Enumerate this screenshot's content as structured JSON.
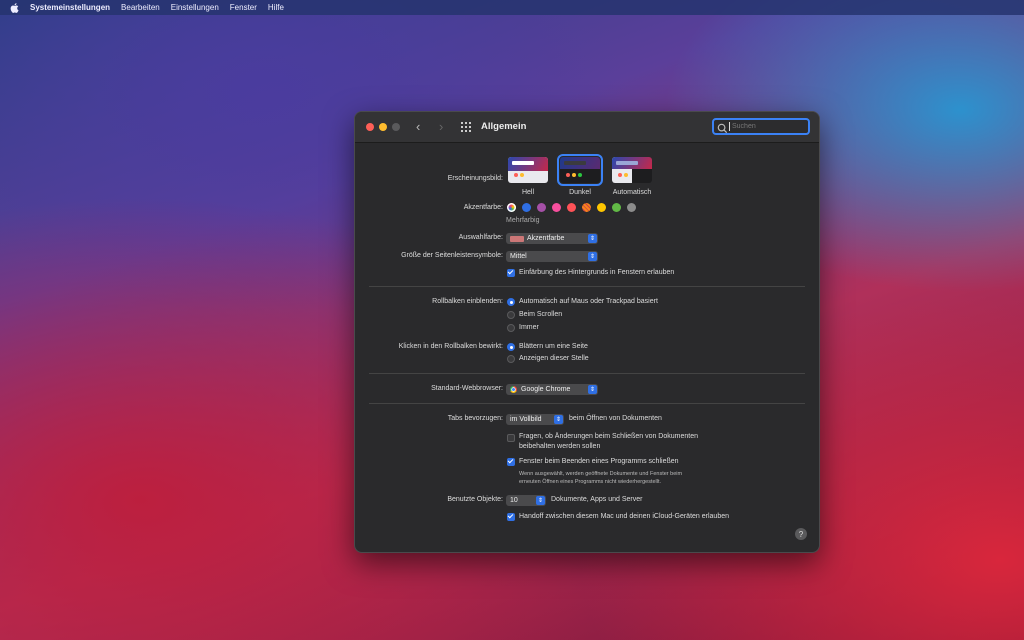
{
  "menubar": {
    "items": [
      {
        "label": "Systemeinstellungen",
        "bold": true
      },
      {
        "label": "Bearbeiten"
      },
      {
        "label": "Einstellungen"
      },
      {
        "label": "Fenster"
      },
      {
        "label": "Hilfe"
      }
    ]
  },
  "window": {
    "title": "Allgemein",
    "search_placeholder": "Suchen"
  },
  "appearance": {
    "label": "Erscheinungsbild:",
    "options": [
      "Hell",
      "Dunkel",
      "Automatisch"
    ],
    "selected": "Dunkel"
  },
  "accent": {
    "label": "Akzentfarbe:",
    "caption": "Mehrfarbig",
    "colors": [
      "#8e8e93",
      "#2f6fe4",
      "#a550a7",
      "#f74f9e",
      "#ff5257",
      "#f7821b",
      "#ffc600",
      "#62ba46",
      "#8c8c8c"
    ]
  },
  "highlight": {
    "label": "Auswahlfarbe:",
    "value": "Akzentfarbe"
  },
  "sidebar_icon_size": {
    "label": "Größe der Seitenleistensymbole:",
    "value": "Mittel"
  },
  "wallpaper_tint": {
    "label": "Einfärbung des Hintergrunds in Fenstern erlauben",
    "checked": true
  },
  "scrollbars": {
    "label": "Rollbalken einblenden:",
    "options": [
      "Automatisch auf Maus oder Trackpad basiert",
      "Beim Scrollen",
      "Immer"
    ],
    "selected": 0
  },
  "click_scrollbar": {
    "label": "Klicken in den Rollbalken bewirkt:",
    "options": [
      "Blättern um eine Seite",
      "Anzeigen dieser Stelle"
    ],
    "selected": 0
  },
  "browser": {
    "label": "Standard-Webbrowser:",
    "value": "Google Chrome"
  },
  "tabs": {
    "label": "Tabs bevorzugen:",
    "value": "im Vollbild",
    "suffix": "beim Öffnen von Dokumenten"
  },
  "ask_keep_changes": {
    "line1": "Fragen, ob Änderungen beim Schließen von Dokumenten",
    "line2": "beibehalten werden sollen",
    "checked": false
  },
  "close_windows": {
    "label": "Fenster beim Beenden eines Programms schließen",
    "note1": "Wenn ausgewählt, werden geöffnete Dokumente und Fenster beim",
    "note2": "erneuten Öffnen eines Programms nicht wiederhergestellt.",
    "checked": true
  },
  "recent_items": {
    "label": "Benutzte Objekte:",
    "value": "10",
    "suffix": "Dokumente, Apps und Server"
  },
  "handoff": {
    "label": "Handoff zwischen diesem Mac und deinen iCloud-Geräten erlauben",
    "checked": true
  },
  "help": "?"
}
